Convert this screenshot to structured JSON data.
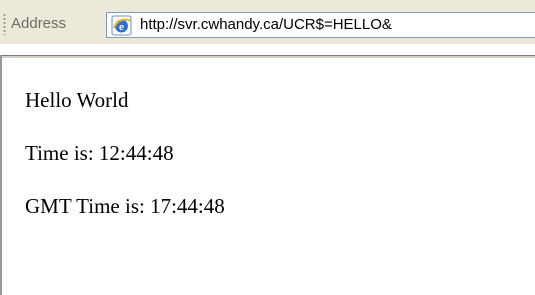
{
  "address_bar": {
    "label": "Address",
    "url": "http://svr.cwhandy.ca/UCR$=HELLO&",
    "page_icon": "ie-page-icon"
  },
  "page": {
    "lines": [
      "Hello World",
      "Time is: 12:44:48",
      "GMT Time is: 17:44:48"
    ]
  }
}
